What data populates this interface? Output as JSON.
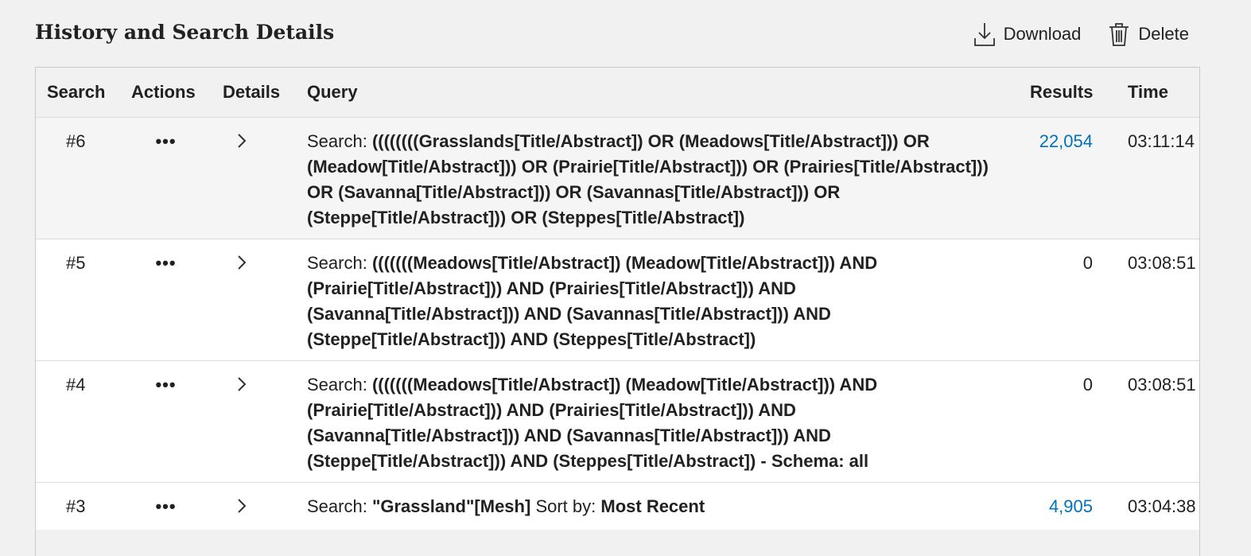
{
  "page": {
    "title": "History and Search Details"
  },
  "toolbar": {
    "download_label": "Download",
    "delete_label": "Delete"
  },
  "table": {
    "headers": {
      "search": "Search",
      "actions": "Actions",
      "details": "Details",
      "query": "Query",
      "results": "Results",
      "time": "Time"
    },
    "rows": [
      {
        "num": "#6",
        "actions_icon": "more-dots-icon",
        "details_icon": "chevron-right-icon",
        "query_prefix": "Search:",
        "query_term": "((((((((Grasslands[Title/Abstract]) OR (Meadows[Title/Abstract])) OR (Meadow[Title/Abstract])) OR (Prairie[Title/Abstract])) OR (Prairies[Title/Abstract])) OR (Savanna[Title/Abstract])) OR (Savannas[Title/Abstract])) OR (Steppe[Title/Abstract])) OR (Steppes[Title/Abstract])",
        "results": "22,054",
        "results_linked": true,
        "time": "03:11:14"
      },
      {
        "num": "#5",
        "actions_icon": "more-dots-icon",
        "details_icon": "chevron-right-icon",
        "query_prefix": "Search:",
        "query_term": "(((((((Meadows[Title/Abstract]) (Meadow[Title/Abstract])) AND (Prairie[Title/Abstract])) AND (Prairies[Title/Abstract])) AND (Savanna[Title/Abstract])) AND (Savannas[Title/Abstract])) AND (Steppe[Title/Abstract])) AND (Steppes[Title/Abstract])",
        "results": "0",
        "results_linked": false,
        "time": "03:08:51"
      },
      {
        "num": "#4",
        "actions_icon": "more-dots-icon",
        "details_icon": "chevron-right-icon",
        "query_prefix": "Search:",
        "query_term": "(((((((Meadows[Title/Abstract]) (Meadow[Title/Abstract])) AND (Prairie[Title/Abstract])) AND (Prairies[Title/Abstract])) AND (Savanna[Title/Abstract])) AND (Savannas[Title/Abstract])) AND (Steppe[Title/Abstract])) AND (Steppes[Title/Abstract]) - Schema: all",
        "results": "0",
        "results_linked": false,
        "time": "03:08:51"
      },
      {
        "num": "#3",
        "actions_icon": "more-dots-icon",
        "details_icon": "chevron-right-icon",
        "query_prefix": "Search:",
        "query_term": "\"Grassland\"[Mesh]",
        "query_sort_label": "Sort by:",
        "query_sort_value": "Most Recent",
        "results": "4,905",
        "results_linked": true,
        "time": "03:04:38"
      }
    ]
  },
  "colors": {
    "link": "#0071bc",
    "background": "#f1f1f1",
    "row_alt": "#ffffff"
  }
}
